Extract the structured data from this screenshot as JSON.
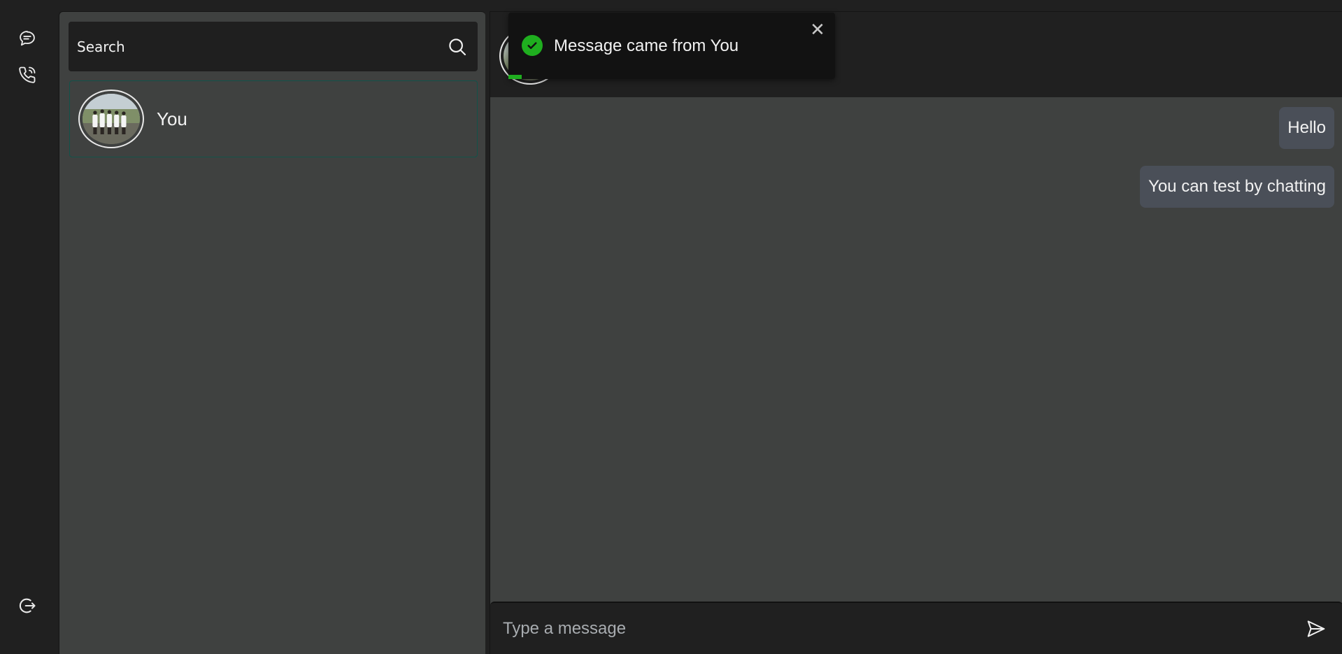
{
  "rail": {
    "icons": [
      "chat-icon",
      "phone-call-icon",
      "logout-icon"
    ]
  },
  "search": {
    "placeholder": "Search",
    "icon": "search-icon"
  },
  "contacts": [
    {
      "name": "You",
      "avatar": "group-photo-avatar",
      "selected": true
    }
  ],
  "chat": {
    "header_avatar": "group-photo-avatar",
    "messages": [
      {
        "text": "Hello",
        "sender": "self"
      },
      {
        "text": "You can test by chatting",
        "sender": "self"
      }
    ],
    "composer": {
      "placeholder": "Type a message",
      "send_icon": "send-icon"
    }
  },
  "toast": {
    "message": "Message came from You",
    "status": "success",
    "icon": "check-circle-icon",
    "close_label": "✕",
    "progress": 0.04
  },
  "colors": {
    "background": "#202020",
    "panel": "#3f4140",
    "bubble": "#4a4f58",
    "accent_green": "#1fae1f",
    "contact_border": "#12534a"
  }
}
